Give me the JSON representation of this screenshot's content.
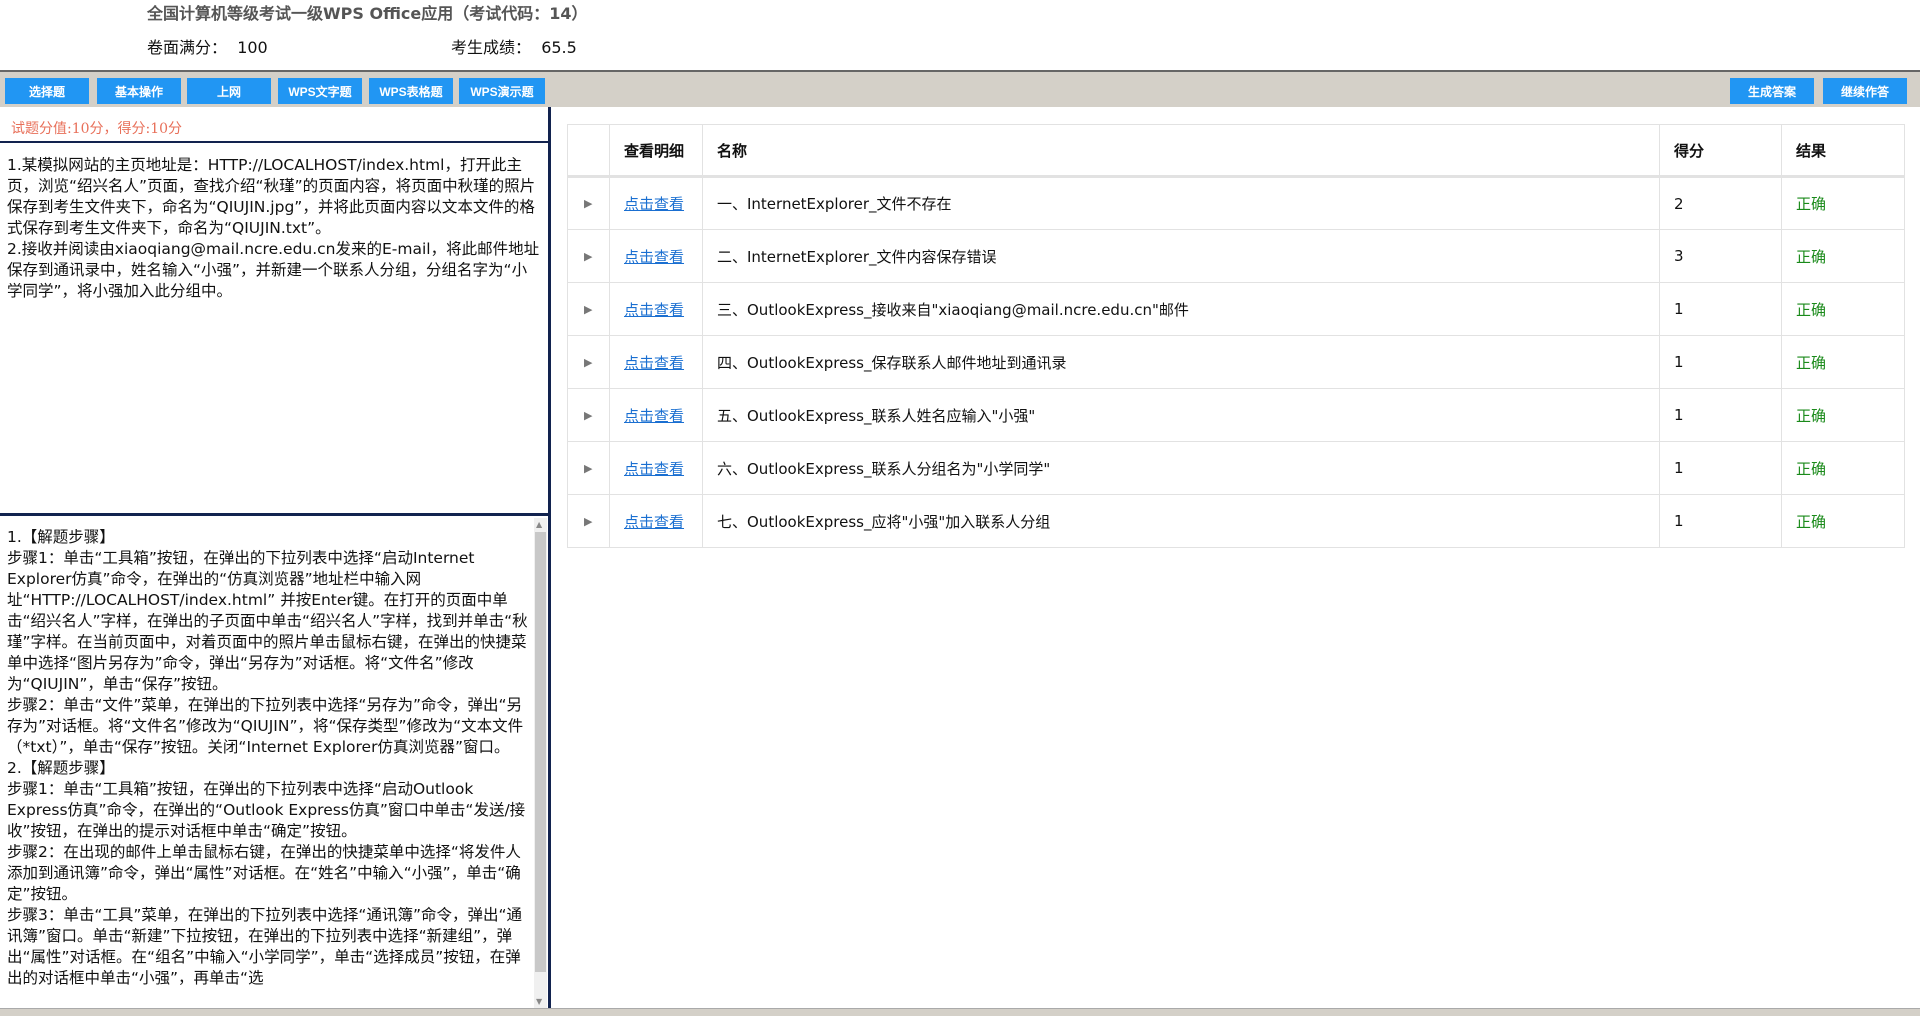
{
  "header": {
    "title": "全国计算机等级考试一级WPS Office应用（考试代码：14）",
    "full_score_label": "卷面满分：",
    "full_score": "100",
    "score_label": "考生成绩：",
    "score": "65.5"
  },
  "toolbar": {
    "tabs": [
      "选择题",
      "基本操作",
      "上网",
      "WPS文字题",
      "WPS表格题",
      "WPS演示题"
    ],
    "generate_answer": "生成答案",
    "continue": "继续作答"
  },
  "left": {
    "score_line": "试题分值:10分，得分:10分",
    "question": [
      "1.某模拟网站的主页地址是：HTTP://LOCALHOST/index.html，打开此主页，浏览“绍兴名人”页面，查找介绍“秋瑾”的页面内容，将页面中秋瑾的照片保存到考生文件夹下，命名为“QIUJIN.jpg”，并将此页面内容以文本文件的格式保存到考生文件夹下，命名为“QIUJIN.txt”。",
      "2.接收并阅读由xiaoqiang@mail.ncre.edu.cn发来的E-mail，将此邮件地址保存到通讯录中，姓名输入“小强”，并新建一个联系人分组，分组名字为“小学同学”，将小强加入此分组中。"
    ],
    "answer": [
      "1.【解题步骤】",
      "步骤1：单击“工具箱”按钮，在弹出的下拉列表中选择“启动Internet Explorer仿真”命令，在弹出的“仿真浏览器”地址栏中输入网址“HTTP://LOCALHOST/index.html” 并按Enter键。在打开的页面中单击“绍兴名人”字样，在弹出的子页面中单击“绍兴名人”字样，找到并单击“秋瑾”字样。在当前页面中，对着页面中的照片单击鼠标右键，在弹出的快捷菜单中选择“图片另存为”命令，弹出“另存为”对话框。将“文件名”修改为“QIUJIN”，单击“保存”按钮。",
      "步骤2：单击“文件”菜单，在弹出的下拉列表中选择“另存为”命令，弹出“另存为”对话框。将“文件名”修改为“QIUJIN”，将“保存类型”修改为“文本文件（*txt）”，单击“保存”按钮。关闭“Internet Explorer仿真浏览器”窗口。",
      "2.【解题步骤】",
      "步骤1：单击“工具箱”按钮，在弹出的下拉列表中选择“启动Outlook Express仿真”命令，在弹出的“Outlook Express仿真”窗口中单击“发送/接收”按钮，在弹出的提示对话框中单击“确定”按钮。",
      "步骤2：在出现的邮件上单击鼠标右键，在弹出的快捷菜单中选择“将发件人添加到通讯簿”命令，弹出“属性”对话框。在“姓名”中输入“小强”，单击“确定”按钮。",
      "步骤3：单击“工具”菜单，在弹出的下拉列表中选择“通讯簿”命令，弹出“通讯簿”窗口。单击“新建”下拉按钮，在弹出的下拉列表中选择“新建组”，弹出“属性”对话框。在“组名”中输入“小学同学”，单击“选择成员”按钮，在弹出的对话框中单击“小强”，再单击“选"
    ]
  },
  "table": {
    "headers": [
      "",
      "查看明细",
      "名称",
      "得分",
      "结果"
    ],
    "rows": [
      {
        "link": "点击查看",
        "name": "一、InternetExplorer_文件不存在",
        "score": "2",
        "result": "正确"
      },
      {
        "link": "点击查看",
        "name": "二、InternetExplorer_文件内容保存错误",
        "score": "3",
        "result": "正确"
      },
      {
        "link": "点击查看",
        "name": "三、OutlookExpress_接收来自\"xiaoqiang@mail.ncre.edu.cn\"邮件",
        "score": "1",
        "result": "正确"
      },
      {
        "link": "点击查看",
        "name": "四、OutlookExpress_保存联系人邮件地址到通讯录",
        "score": "1",
        "result": "正确"
      },
      {
        "link": "点击查看",
        "name": "五、OutlookExpress_联系人姓名应输入\"小强\"",
        "score": "1",
        "result": "正确"
      },
      {
        "link": "点击查看",
        "name": "六、OutlookExpress_联系人分组名为\"小学同学\"",
        "score": "1",
        "result": "正确"
      },
      {
        "link": "点击查看",
        "name": "七、OutlookExpress_应将\"小强\"加入联系人分组",
        "score": "1",
        "result": "正确"
      }
    ]
  },
  "colors": {
    "button": "#2196f3",
    "result_ok": "#1a8a1a",
    "score_line": "#e8705a",
    "link": "#1a6fd1"
  }
}
